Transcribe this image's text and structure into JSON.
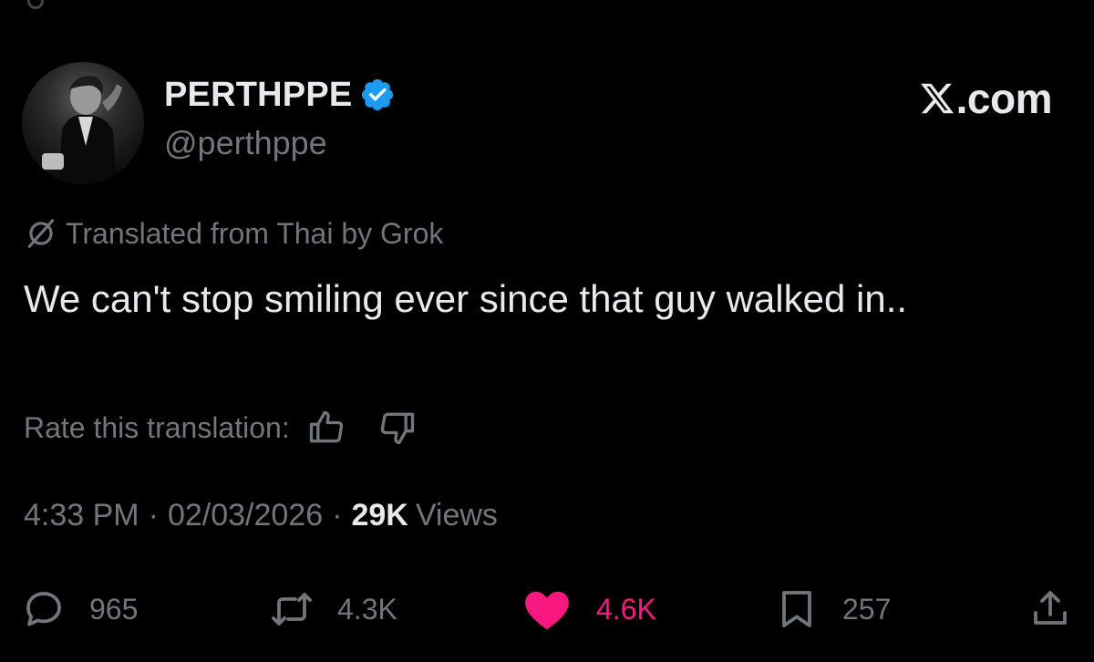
{
  "profile": {
    "display_name": "PERTHPPE",
    "handle": "@perthppe",
    "verified": true,
    "avatar_icon": "profile-photo"
  },
  "brand": {
    "site_label": ".com",
    "logo_icon": "x-logo-icon"
  },
  "translation": {
    "notice": "Translated from Thai by Grok",
    "icon": "grok-icon",
    "rate_label": "Rate this translation:"
  },
  "tweet": {
    "text": "We can't stop smiling ever since that guy walked in.."
  },
  "meta": {
    "time": "4:33 PM",
    "separator": "·",
    "date": "02/03/2026",
    "views_count": "29K",
    "views_label": "Views"
  },
  "actions": {
    "replies": "965",
    "reposts": "4.3K",
    "likes": "4.6K",
    "bookmarks": "257"
  },
  "colors": {
    "background": "#000000",
    "text_primary": "#e7e9ea",
    "text_secondary": "#71767b",
    "like_pink": "#f91880",
    "verified_blue": "#1d9bf0"
  }
}
